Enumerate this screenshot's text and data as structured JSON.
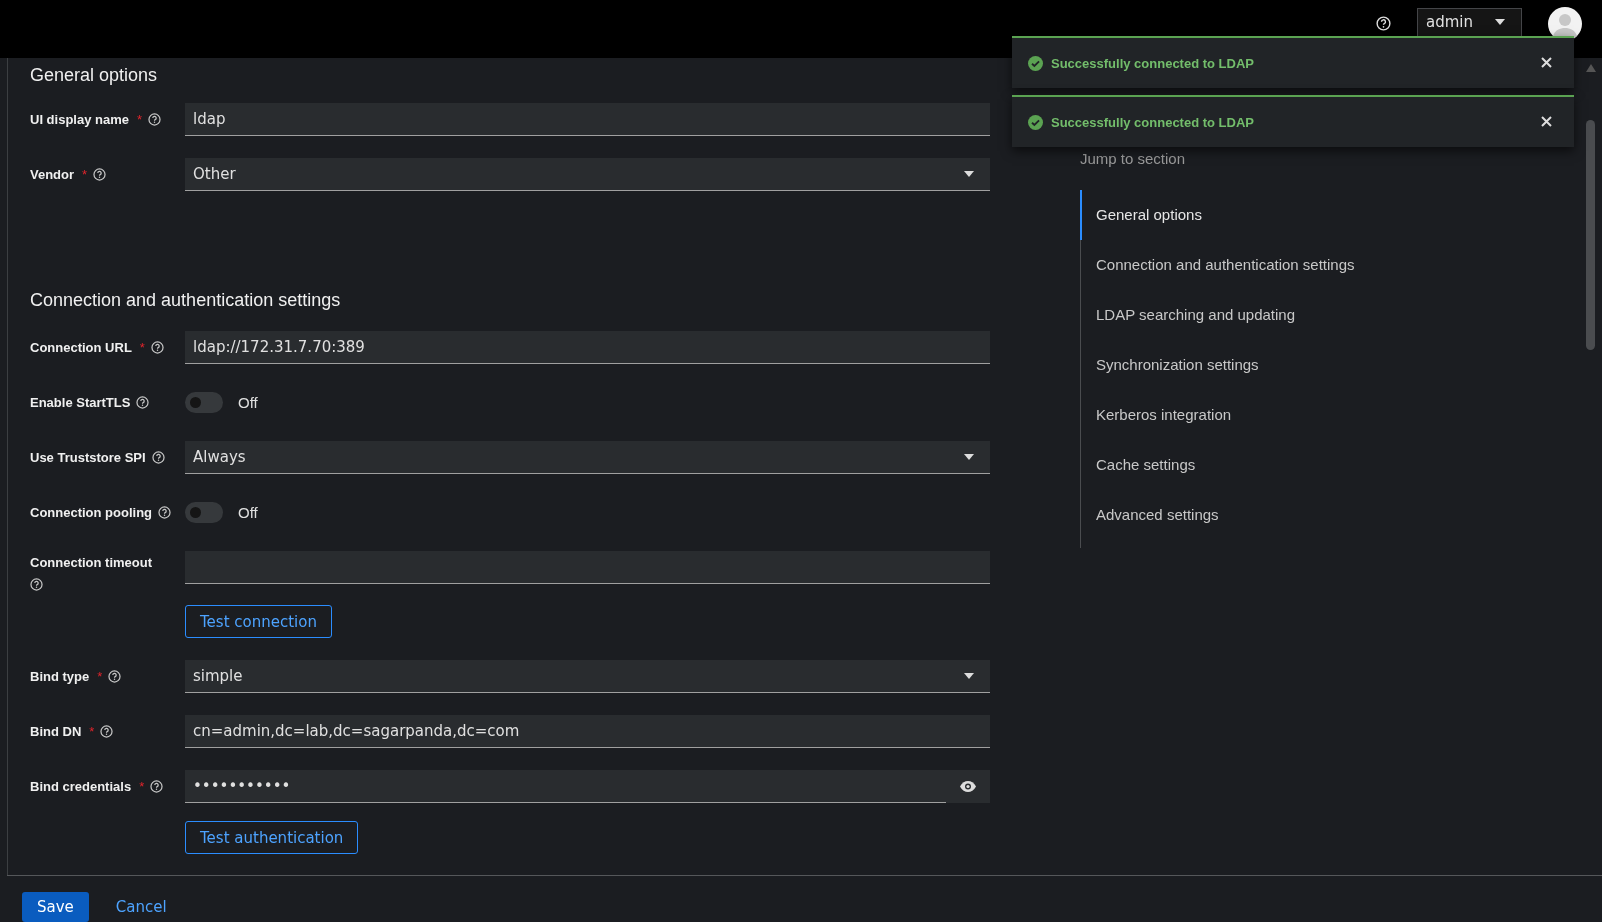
{
  "header": {
    "user": "admin"
  },
  "form": [
    {
      "kind": "heading",
      "text": "General options"
    },
    {
      "kind": "text",
      "label": "UI display name",
      "required_mark": "*",
      "value": "ldap"
    },
    {
      "kind": "select",
      "label": "Vendor",
      "required_mark": "*",
      "value": "Other"
    },
    {
      "kind": "spacer"
    },
    {
      "kind": "heading",
      "text": "Connection and authentication settings"
    },
    {
      "kind": "text",
      "label": "Connection URL",
      "required_mark": "*",
      "value": "ldap://172.31.7.70:389"
    },
    {
      "kind": "switch",
      "label": "Enable StartTLS",
      "on": false,
      "state_text": "Off"
    },
    {
      "kind": "select",
      "label": "Use Truststore SPI",
      "value": "Always"
    },
    {
      "kind": "switch",
      "label": "Connection pooling",
      "on": false,
      "state_text": "Off"
    },
    {
      "kind": "tall",
      "label": "Connection timeout"
    },
    {
      "kind": "button",
      "text": "Test connection"
    },
    {
      "kind": "select",
      "label": "Bind type",
      "required_mark": "*",
      "value": "simple"
    },
    {
      "kind": "text",
      "label": "Bind DN",
      "required_mark": "*",
      "value": "cn=admin,dc=lab,dc=sagarpanda,dc=com"
    },
    {
      "kind": "password",
      "label": "Bind credentials",
      "required_mark": "*",
      "value": "•••••••••••"
    },
    {
      "kind": "button",
      "text": "Test authentication"
    }
  ],
  "jump": {
    "title": "Jump to section",
    "items": [
      {
        "label": "General options",
        "selected": true
      },
      {
        "label": "Connection and authentication settings",
        "selected": false
      },
      {
        "label": "LDAP searching and updating",
        "selected": false
      },
      {
        "label": "Synchronization settings",
        "selected": false
      },
      {
        "label": "Kerberos integration",
        "selected": false
      },
      {
        "label": "Cache settings",
        "selected": false
      },
      {
        "label": "Advanced settings",
        "selected": false
      }
    ]
  },
  "toasts": [
    {
      "text": "Successfully connected to LDAP"
    },
    {
      "text": "Successfully connected to LDAP"
    }
  ],
  "footer": {
    "save": "Save",
    "cancel": "Cancel"
  }
}
